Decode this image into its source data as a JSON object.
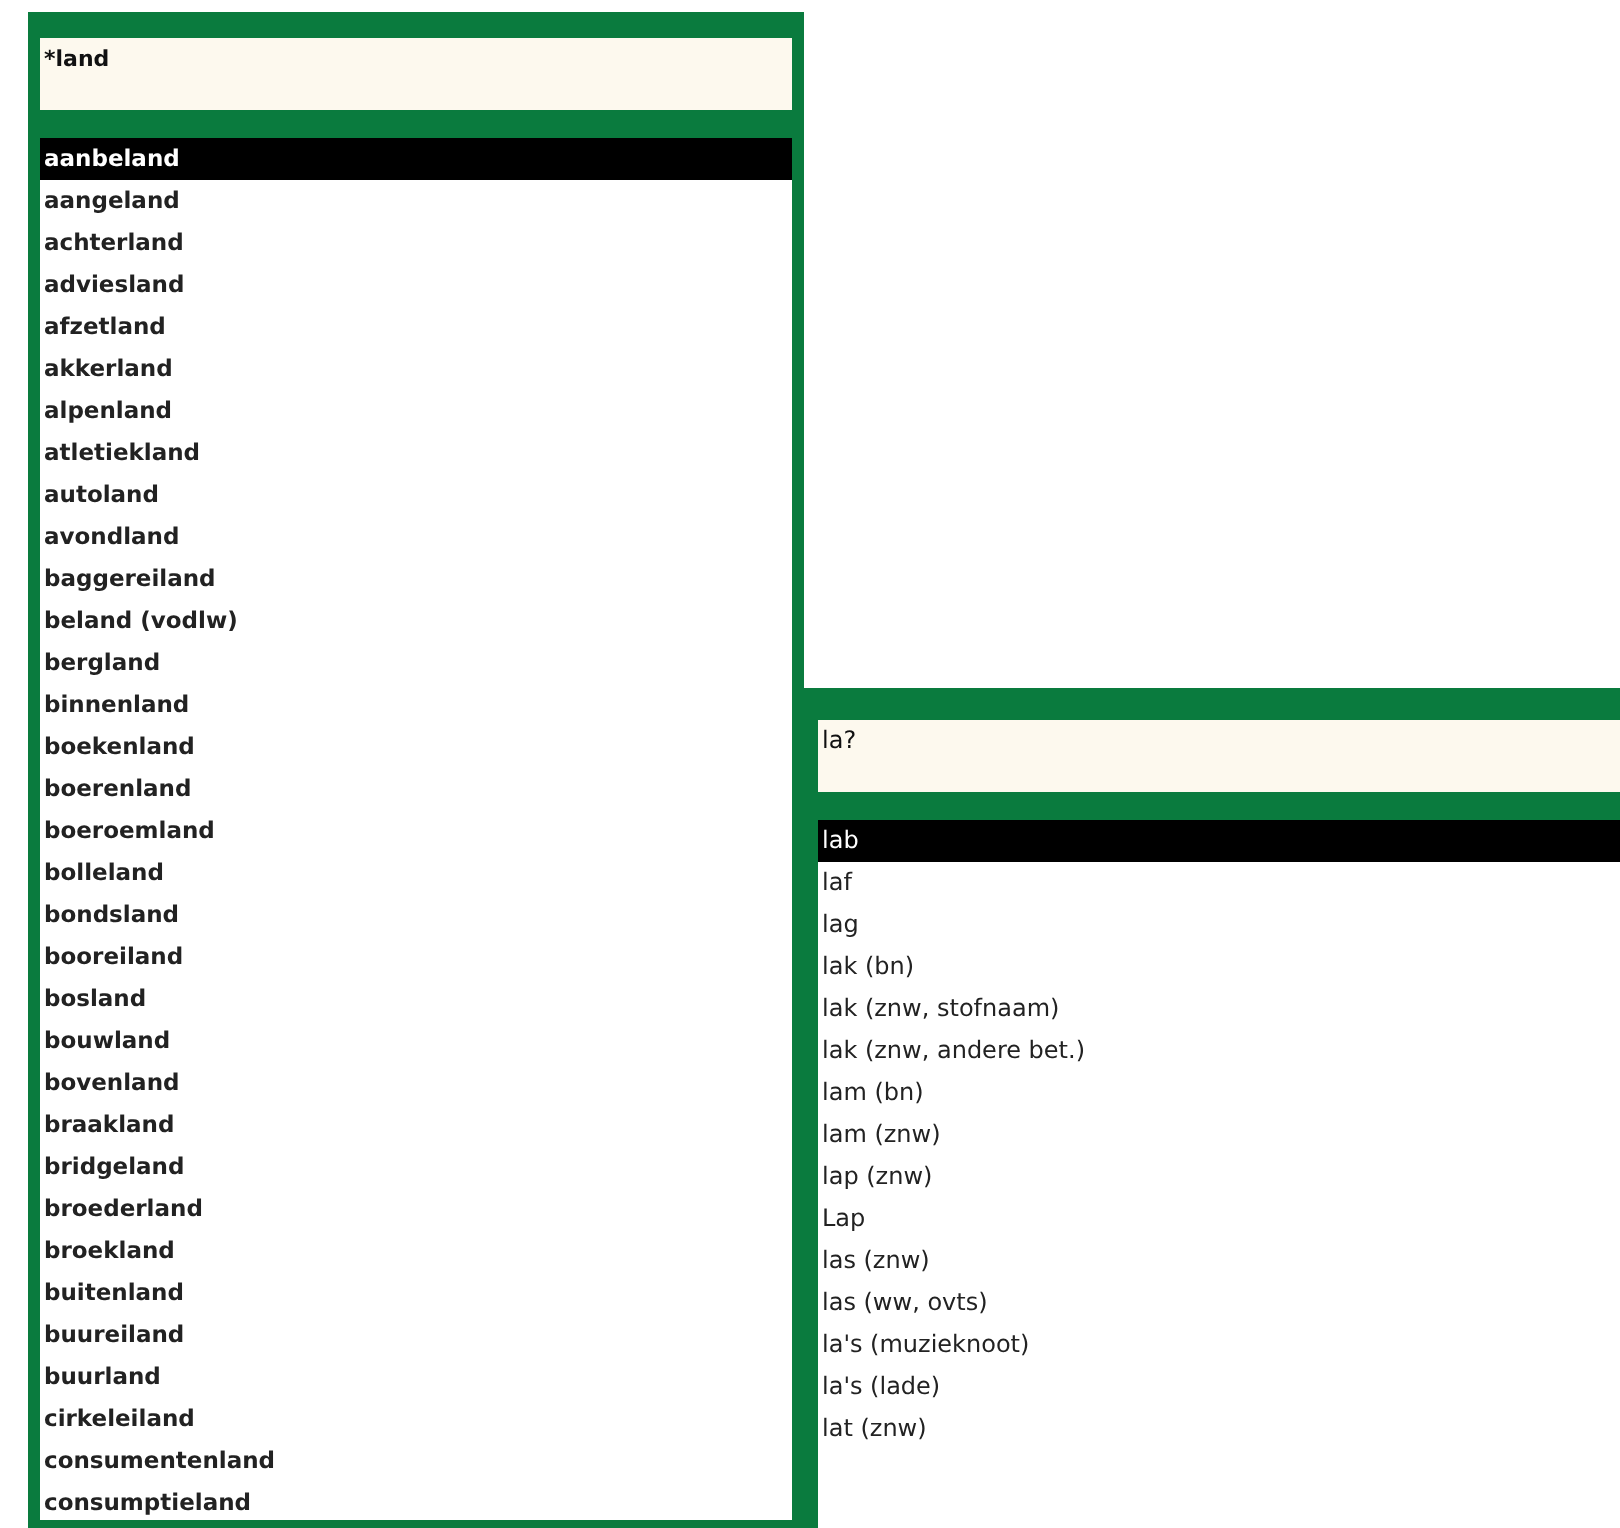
{
  "panels": [
    {
      "search": {
        "value": "*land"
      },
      "items": [
        {
          "label": "aanbeland",
          "selected": true
        },
        {
          "label": "aangeland",
          "selected": false
        },
        {
          "label": "achterland",
          "selected": false
        },
        {
          "label": "adviesland",
          "selected": false
        },
        {
          "label": "afzetland",
          "selected": false
        },
        {
          "label": "akkerland",
          "selected": false
        },
        {
          "label": "alpenland",
          "selected": false
        },
        {
          "label": "atletiekland",
          "selected": false
        },
        {
          "label": "autoland",
          "selected": false
        },
        {
          "label": "avondland",
          "selected": false
        },
        {
          "label": "baggereiland",
          "selected": false
        },
        {
          "label": "beland (vodlw)",
          "selected": false
        },
        {
          "label": "bergland",
          "selected": false
        },
        {
          "label": "binnenland",
          "selected": false
        },
        {
          "label": "boekenland",
          "selected": false
        },
        {
          "label": "boerenland",
          "selected": false
        },
        {
          "label": "boeroemland",
          "selected": false
        },
        {
          "label": "bolleland",
          "selected": false
        },
        {
          "label": "bondsland",
          "selected": false
        },
        {
          "label": "booreiland",
          "selected": false
        },
        {
          "label": "bosland",
          "selected": false
        },
        {
          "label": "bouwland",
          "selected": false
        },
        {
          "label": "bovenland",
          "selected": false
        },
        {
          "label": "braakland",
          "selected": false
        },
        {
          "label": "bridgeland",
          "selected": false
        },
        {
          "label": "broederland",
          "selected": false
        },
        {
          "label": "broekland",
          "selected": false
        },
        {
          "label": "buitenland",
          "selected": false
        },
        {
          "label": "buureiland",
          "selected": false
        },
        {
          "label": "buurland",
          "selected": false
        },
        {
          "label": "cirkeleiland",
          "selected": false
        },
        {
          "label": "consumentenland",
          "selected": false
        },
        {
          "label": "consumptieland",
          "selected": false
        }
      ]
    },
    {
      "search": {
        "value": "la?"
      },
      "items": [
        {
          "label": "lab",
          "selected": true
        },
        {
          "label": "laf",
          "selected": false
        },
        {
          "label": "lag",
          "selected": false
        },
        {
          "label": "lak (bn)",
          "selected": false
        },
        {
          "label": "lak (znw, stofnaam)",
          "selected": false
        },
        {
          "label": "lak (znw, andere bet.)",
          "selected": false
        },
        {
          "label": "lam (bn)",
          "selected": false
        },
        {
          "label": "lam (znw)",
          "selected": false
        },
        {
          "label": "lap (znw)",
          "selected": false
        },
        {
          "label": "Lap",
          "selected": false
        },
        {
          "label": "las (znw)",
          "selected": false
        },
        {
          "label": "las (ww, ovts)",
          "selected": false
        },
        {
          "label": "la's (muzieknoot)",
          "selected": false
        },
        {
          "label": "la's (lade)",
          "selected": false
        },
        {
          "label": "lat (znw)",
          "selected": false
        }
      ]
    }
  ]
}
